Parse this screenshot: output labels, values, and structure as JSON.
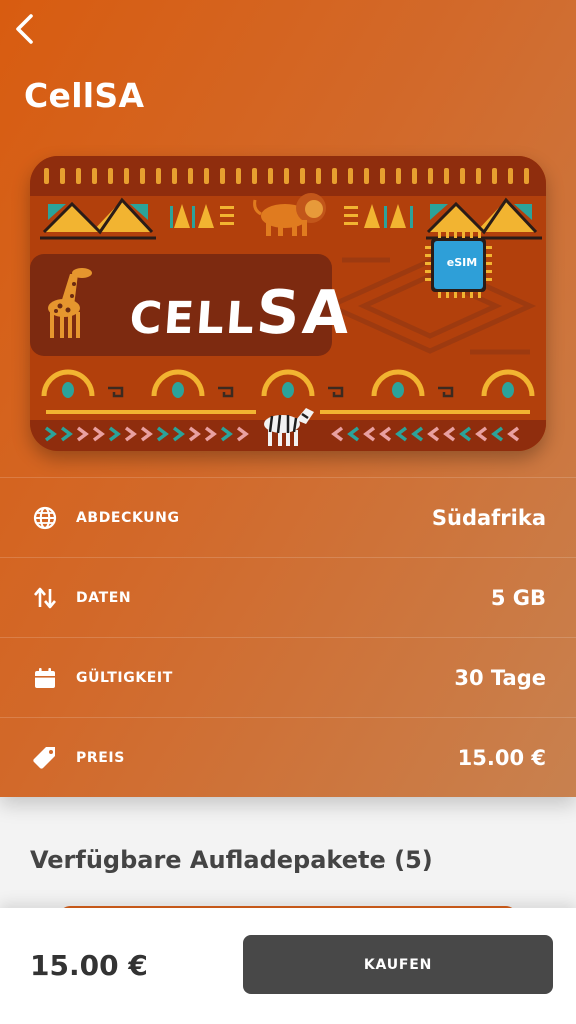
{
  "header": {
    "title": "CellSA"
  },
  "card": {
    "logo_small": "CELL",
    "logo_big": "SA",
    "chip_label": "eSIM"
  },
  "details": [
    {
      "icon": "globe-icon",
      "label": "ABDECKUNG",
      "value": "Südafrika"
    },
    {
      "icon": "arrows-up-down-icon",
      "label": "DATEN",
      "value": "5 GB"
    },
    {
      "icon": "calendar-icon",
      "label": "GÜLTIGKEIT",
      "value": "30 Tage"
    },
    {
      "icon": "price-tag-icon",
      "label": "PREIS",
      "value": "15.00 €"
    }
  ],
  "topups": {
    "title": "Verfügbare Aufladepakete (5)"
  },
  "footer": {
    "price": "15.00 €",
    "buy_label": "KAUFEN"
  },
  "colors": {
    "hero_start": "#d85c10",
    "hero_end": "#c8814f",
    "button": "#484848"
  }
}
